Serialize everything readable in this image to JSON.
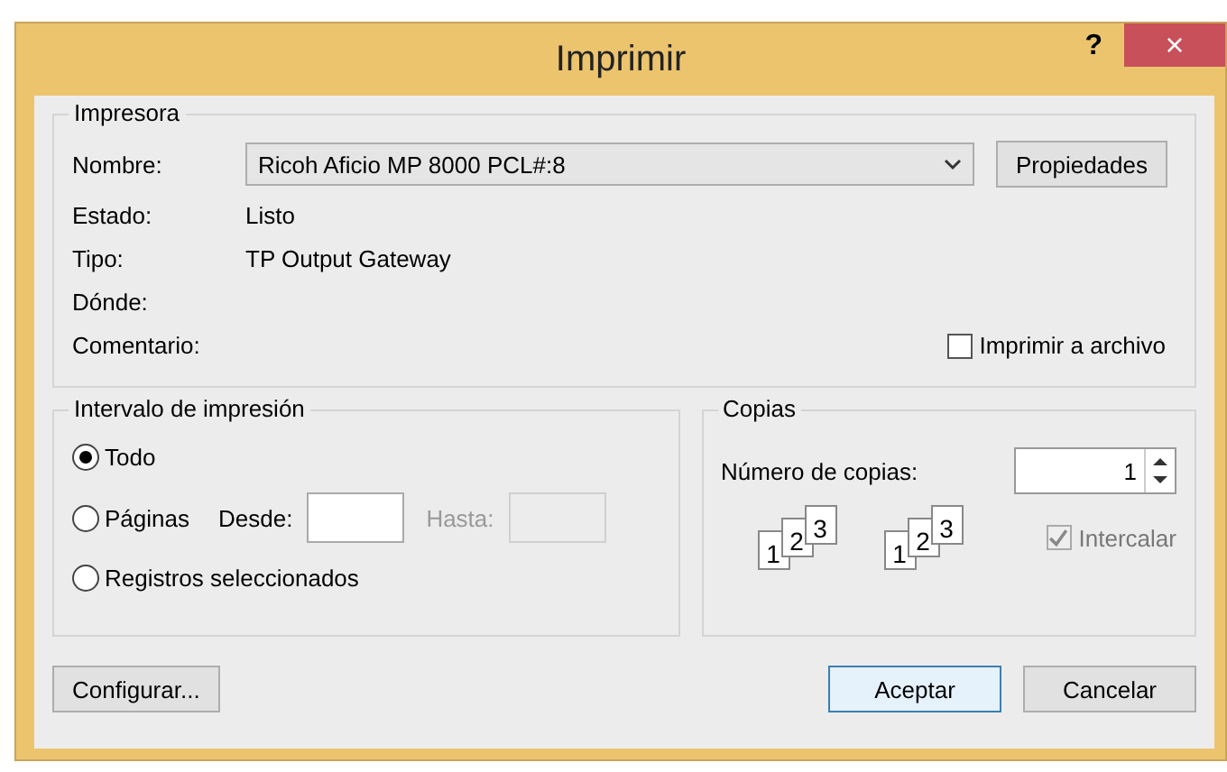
{
  "window": {
    "title": "Imprimir",
    "help": "?",
    "close": "×"
  },
  "printer": {
    "legend": "Impresora",
    "name": {
      "label": "Nombre:",
      "value": "Ricoh Aficio MP 8000 PCL#:8"
    },
    "properties_button": "Propiedades",
    "fields": [
      {
        "label": "Estado:",
        "value": "Listo"
      },
      {
        "label": "Tipo:",
        "value": "TP Output Gateway"
      },
      {
        "label": "Dónde:"
      },
      {
        "label": "Comentario:"
      }
    ],
    "print_to_file": {
      "label": "Imprimir a archivo",
      "checked": false
    }
  },
  "range": {
    "legend": "Intervalo de impresión",
    "options": [
      {
        "label": "Todo",
        "selected": true
      },
      {
        "label": "Páginas",
        "selected": false
      },
      {
        "label": "Registros seleccionados",
        "selected": false
      }
    ],
    "from": {
      "label": "Desde:",
      "disabled": false
    },
    "to": {
      "label": "Hasta:",
      "disabled": true
    }
  },
  "copies": {
    "legend": "Copias",
    "count_label": "Número de copias:",
    "count": "1",
    "collate_pages": [
      [
        "1",
        "2",
        "3"
      ],
      [
        "1",
        "2",
        "3"
      ]
    ],
    "collate": {
      "label": "Intercalar",
      "checked": true,
      "disabled": true
    }
  },
  "buttons": [
    {
      "label": "Configurar...",
      "default": false
    },
    {
      "label": "Aceptar",
      "default": true
    },
    {
      "label": "Cancelar",
      "default": false
    }
  ]
}
